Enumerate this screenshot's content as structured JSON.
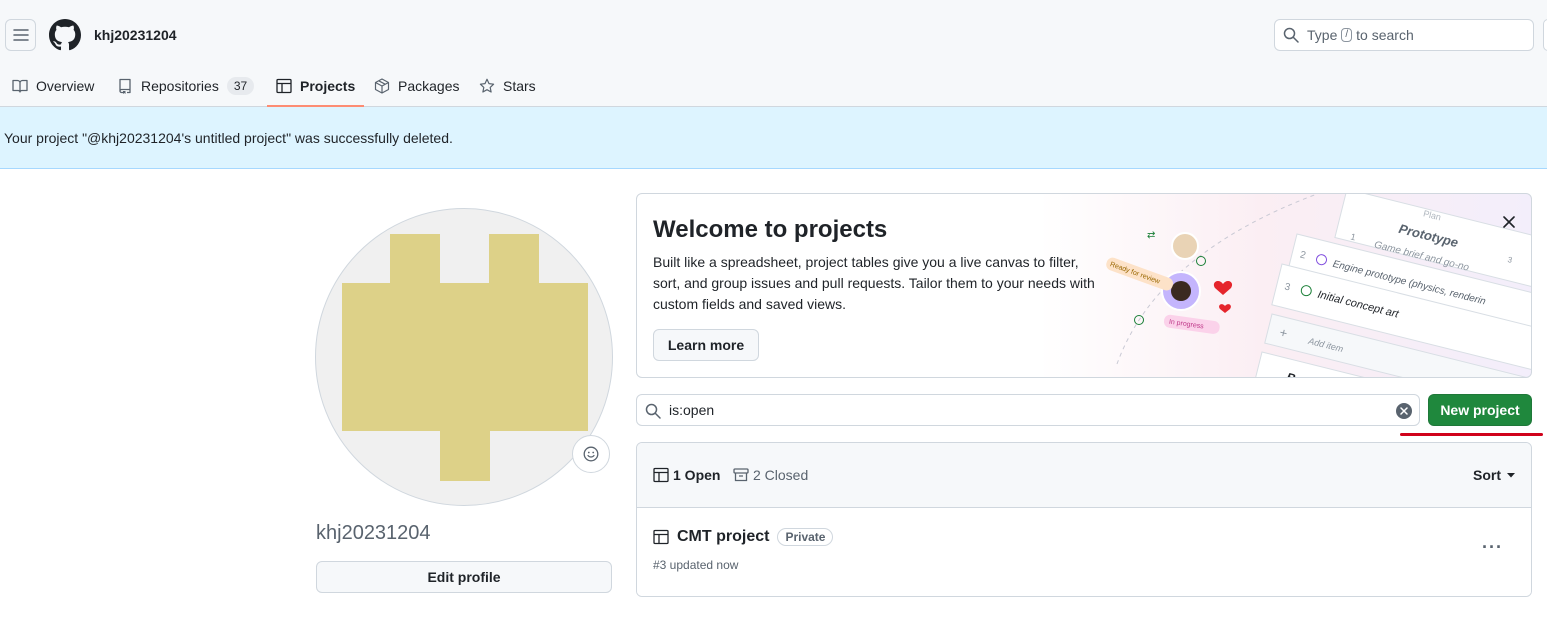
{
  "header": {
    "username": "khj20231204",
    "search": {
      "prefix": "Type",
      "key": "/",
      "suffix": "to search"
    }
  },
  "tabs": [
    {
      "label": "Overview",
      "icon": "book-icon"
    },
    {
      "label": "Repositories",
      "icon": "repo-icon",
      "count": "37"
    },
    {
      "label": "Projects",
      "icon": "table-icon",
      "active": true
    },
    {
      "label": "Packages",
      "icon": "package-icon"
    },
    {
      "label": "Stars",
      "icon": "star-icon"
    }
  ],
  "flash": {
    "message": "Your project \"@khj20231204's untitled project\" was successfully deleted."
  },
  "profile": {
    "name": "khj20231204",
    "edit_label": "Edit profile"
  },
  "welcome": {
    "title": "Welcome to projects",
    "description": "Built like a spreadsheet, project tables give you a live canvas to filter, sort, and group issues and pull requests. Tailor them to your needs with custom fields and saved views.",
    "learn_more": "Learn more",
    "illustration": {
      "prototype": "Prototype",
      "row2": "Game brief and go-no",
      "row2_num": "1",
      "row3": "Engine prototype (physics, renderin",
      "row3_num": "2",
      "row4": "Initial concept art",
      "row4_num": "3",
      "add_item": "Add item",
      "beta": "Bet",
      "ready": "Ready for review",
      "in_progress": "In progress",
      "plan": "Plan",
      "badge3": "3"
    }
  },
  "filter": {
    "query": "is:open"
  },
  "new_project_label": "New project",
  "list": {
    "open_label": "1 Open",
    "closed_label": "2 Closed",
    "sort_label": "Sort",
    "projects": [
      {
        "name": "CMT project",
        "visibility": "Private",
        "subtitle": "#3 updated now"
      }
    ]
  },
  "colors": {
    "accent_green": "#1f883d",
    "flash_bg": "#ddf4ff",
    "active_tab_underline": "#fd8c73",
    "avatar_color": "#ddd188",
    "annotation_red": "#d0021b"
  }
}
